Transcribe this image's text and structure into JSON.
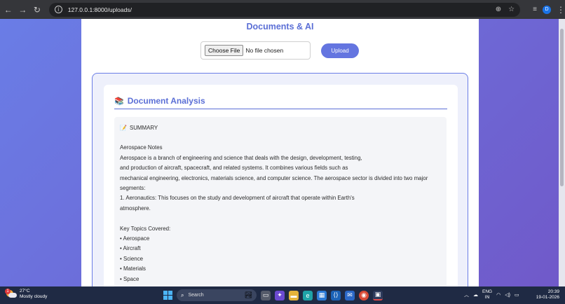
{
  "browser": {
    "url": "127.0.0.1:8000/uploads/",
    "profile_initial": "D"
  },
  "page": {
    "title": "Documents & AI",
    "choose_file_label": "Choose File",
    "no_file_text": "No file chosen",
    "upload_label": "Upload"
  },
  "analysis": {
    "icon": "books-icon",
    "title": "Document Analysis",
    "summary_icon": "memo-icon",
    "summary_label": "SUMMARY",
    "lines": [
      "Aerospace Notes",
      "Aerospace is a branch of engineering and science that deals with the design, development, testing,",
      "and production of aircraft, spacecraft, and related systems. It combines various fields such as",
      "mechanical engineering, electronics, materials science, and computer science. The aerospace sector is divided into two major",
      "segments:",
      "1. Aeronautics: This focuses on the study and development of aircraft that operate within Earth's",
      "atmosphere.",
      "",
      "Key Topics Covered:",
      "• Aerospace",
      "• Aircraft",
      "• Science",
      "• Materials",
      "• Space"
    ]
  },
  "taskbar": {
    "weather_temp": "27°C",
    "weather_desc": "Mostly cloudy",
    "weather_badge": "1",
    "search_placeholder": "Search",
    "lang_line1": "ENG",
    "lang_line2": "IN",
    "time": "20:39",
    "date": "19-01-2026"
  }
}
